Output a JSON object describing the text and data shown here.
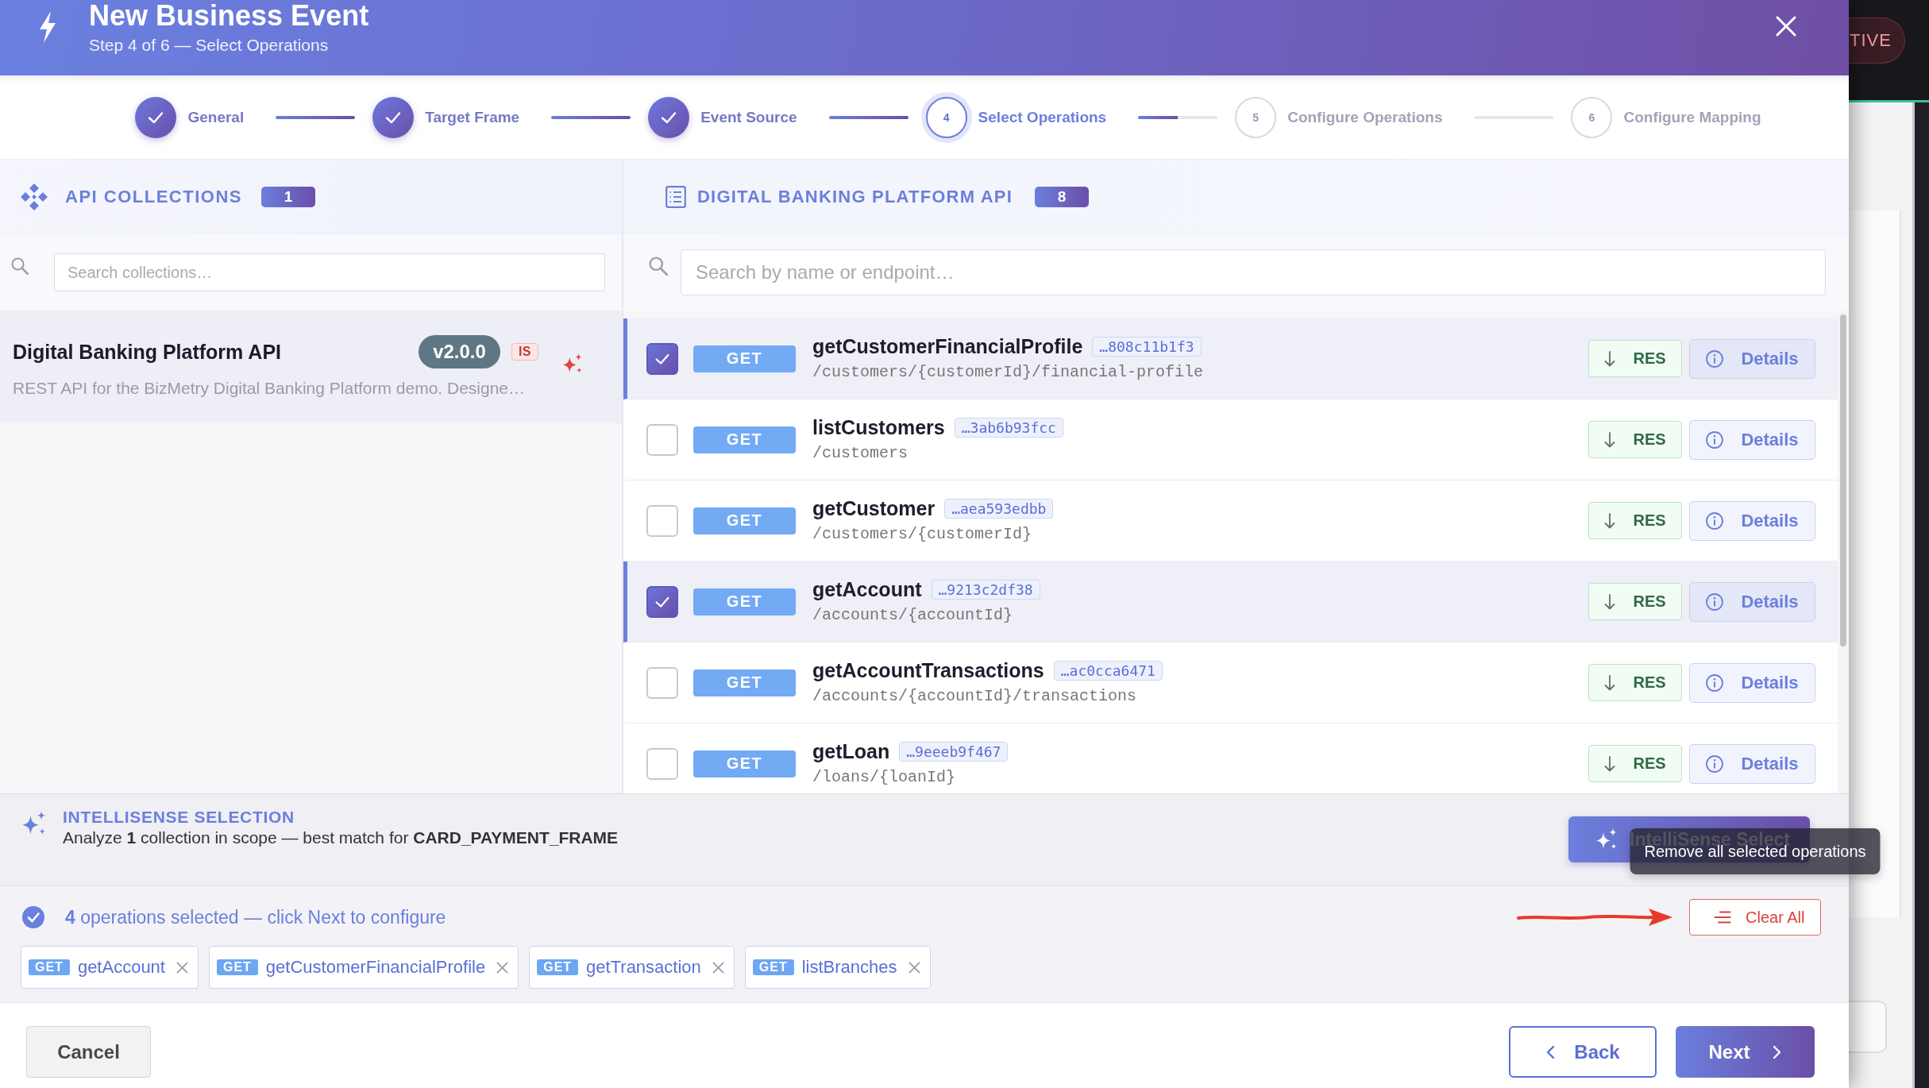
{
  "modal": {
    "title": "New Business Event",
    "subtitle": "Step 4 of 6 — Select Operations"
  },
  "stepper": [
    {
      "label": "General",
      "completed": true,
      "current": false
    },
    {
      "label": "Target Frame",
      "completed": true,
      "current": false
    },
    {
      "label": "Event Source",
      "completed": true,
      "current": false
    },
    {
      "number": "4",
      "label": "Select Operations",
      "completed": false,
      "current": true
    },
    {
      "number": "5",
      "label": "Configure Operations",
      "completed": false,
      "current": false
    },
    {
      "number": "6",
      "label": "Configure Mapping",
      "completed": false,
      "current": false
    }
  ],
  "collections_panel": {
    "title": "API COLLECTIONS",
    "count": "1",
    "search": {
      "placeholder": "Search collections…"
    },
    "items": [
      {
        "name": "Digital Banking Platform API",
        "version": "v2.0.0",
        "tag": "IS",
        "description": "REST API for the BizMetry Digital Banking Platform demo. Designe…",
        "selected": true
      }
    ]
  },
  "operations_panel": {
    "title": "DIGITAL BANKING PLATFORM API",
    "count": "8",
    "search": {
      "placeholder": "Search by name or endpoint…"
    },
    "operations": [
      {
        "method": "GET",
        "name": "getCustomerFinancialProfile",
        "hash": "…808c11b1f3",
        "path": "/customers/{customerId}/financial-profile",
        "checked": true,
        "response_label": "RES",
        "details_label": "Details"
      },
      {
        "method": "GET",
        "name": "listCustomers",
        "hash": "…3ab6b93fcc",
        "path": "/customers",
        "checked": false,
        "response_label": "RES",
        "details_label": "Details"
      },
      {
        "method": "GET",
        "name": "getCustomer",
        "hash": "…aea593edbb",
        "path": "/customers/{customerId}",
        "checked": false,
        "response_label": "RES",
        "details_label": "Details"
      },
      {
        "method": "GET",
        "name": "getAccount",
        "hash": "…9213c2df38",
        "path": "/accounts/{accountId}",
        "checked": true,
        "response_label": "RES",
        "details_label": "Details"
      },
      {
        "method": "GET",
        "name": "getAccountTransactions",
        "hash": "…ac0cca6471",
        "path": "/accounts/{accountId}/transactions",
        "checked": false,
        "response_label": "RES",
        "details_label": "Details"
      },
      {
        "method": "GET",
        "name": "getLoan",
        "hash": "…9eeeb9f467",
        "path": "/loans/{loanId}",
        "checked": false,
        "response_label": "RES",
        "details_label": "Details"
      }
    ]
  },
  "intellisense": {
    "title": "INTELLISENSE SELECTION",
    "description": "Analyze **1** collection in scope — best match for **CARD_PAYMENT_FRAME**",
    "button": "IntelliSense Select"
  },
  "selection": {
    "summary": "**4** operations selected — click Next to configure",
    "clear_button": "Clear All",
    "tooltip": "Remove all selected operations",
    "chips": [
      {
        "method": "GET",
        "name": "getAccount"
      },
      {
        "method": "GET",
        "name": "getCustomerFinancialProfile"
      },
      {
        "method": "GET",
        "name": "getTransaction"
      },
      {
        "method": "GET",
        "name": "listBranches"
      }
    ]
  },
  "footer": {
    "cancel": "Cancel",
    "back": "Back",
    "next": "Next"
  },
  "background": {
    "badge": "TIVE"
  }
}
